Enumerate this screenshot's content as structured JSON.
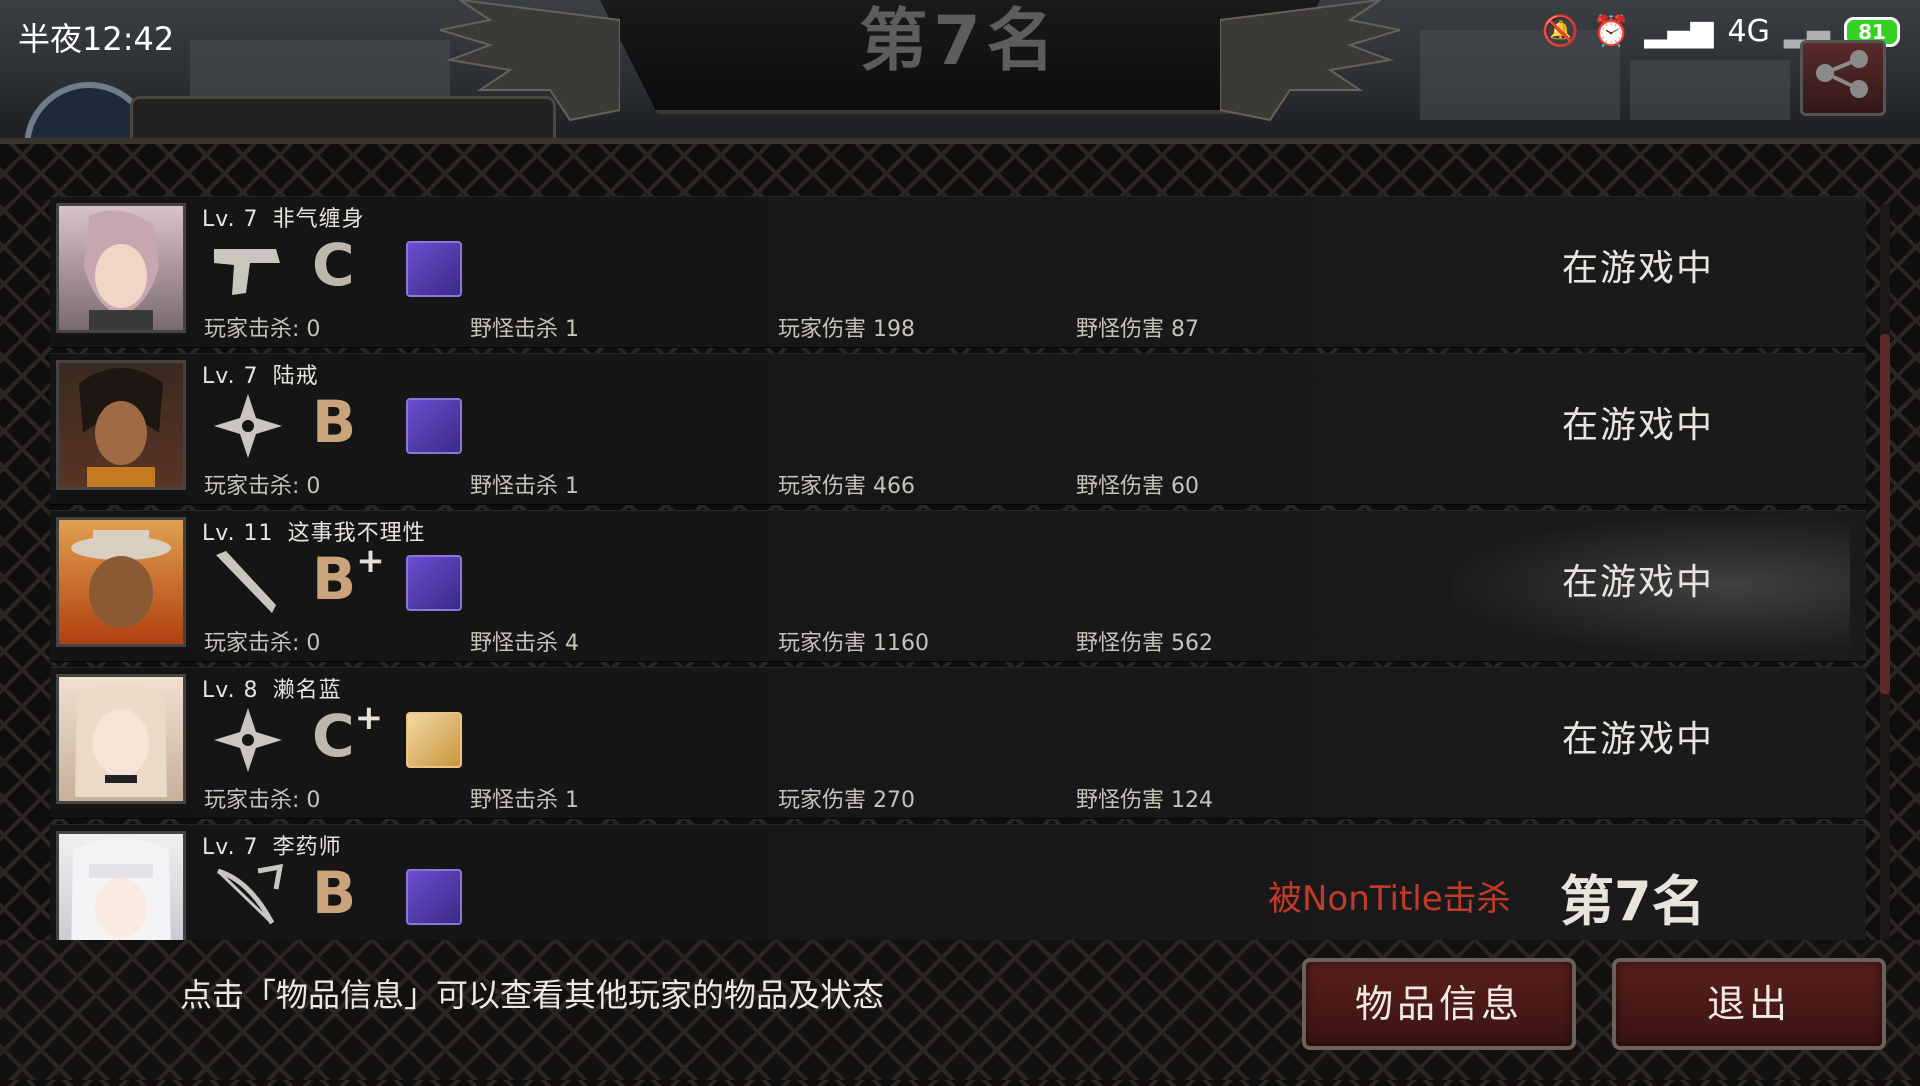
{
  "status_bar": {
    "time": "半夜12:42",
    "network": "4G",
    "battery": "81"
  },
  "header": {
    "title": "第7名",
    "partial_player_name": "李药师"
  },
  "players": [
    {
      "level": "Lv. 7",
      "name": "非气缠身",
      "weapon_icon": "pistol-icon",
      "grade": "C",
      "grade_plus": "",
      "item_color": "#6a4ed0",
      "player_kills": "玩家击杀: 0",
      "monster_kills": "野怪击杀 1",
      "player_damage": "玩家伤害 198",
      "monster_damage": "野怪伤害 87",
      "status": "在游戏中"
    },
    {
      "level": "Lv. 7",
      "name": "陆戒",
      "weapon_icon": "shuriken-icon",
      "grade": "B",
      "grade_plus": "",
      "item_color": "#6a4ed0",
      "player_kills": "玩家击杀: 0",
      "monster_kills": "野怪击杀 1",
      "player_damage": "玩家伤害 466",
      "monster_damage": "野怪伤害 60",
      "status": "在游戏中"
    },
    {
      "level": "Lv. 11",
      "name": "这事我不理性",
      "weapon_icon": "bat-icon",
      "grade": "B",
      "grade_plus": "+",
      "item_color": "#6a4ed0",
      "player_kills": "玩家击杀: 0",
      "monster_kills": "野怪击杀 4",
      "player_damage": "玩家伤害 1160",
      "monster_damage": "野怪伤害 562",
      "status": "在游戏中"
    },
    {
      "level": "Lv. 8",
      "name": "濑名蓝",
      "weapon_icon": "shuriken-icon",
      "grade": "C",
      "grade_plus": "+",
      "item_color": "#e0b46a",
      "player_kills": "玩家击杀: 0",
      "monster_kills": "野怪击杀 1",
      "player_damage": "玩家伤害 270",
      "monster_damage": "野怪伤害 124",
      "status": "在游戏中"
    },
    {
      "level": "Lv. 7",
      "name": "李药师",
      "weapon_icon": "crossbow-icon",
      "grade": "B",
      "grade_plus": "",
      "item_color": "#6a4ed0",
      "killed_by": "被NonTitle击杀",
      "rank": "第7名"
    }
  ],
  "footer": {
    "hint": "点击「物品信息」可以查看其他玩家的物品及状态",
    "info_button": "物品信息",
    "exit_button": "退出"
  }
}
